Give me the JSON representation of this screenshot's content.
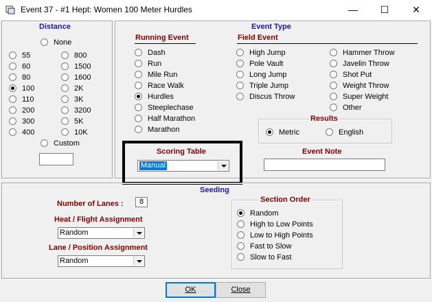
{
  "window": {
    "title": "Event 37 - #1 Hept: Women 100 Meter Hurdles",
    "controls": {
      "minimize": "—",
      "maximize": "☐",
      "close": "✕"
    }
  },
  "distance": {
    "title": "Distance",
    "none_label": "None",
    "options_left": [
      "55",
      "60",
      "80",
      "100",
      "110",
      "200",
      "300",
      "400"
    ],
    "options_right": [
      "800",
      "1500",
      "1600",
      "2K",
      "3K",
      "3200",
      "5K",
      "10K"
    ],
    "selected": "100",
    "custom_label": "Custom",
    "custom_value": ""
  },
  "event_type": {
    "title": "Event Type",
    "running_title": "Running Event",
    "running": [
      "Dash",
      "Run",
      "Mile Run",
      "Race Walk",
      "Hurdles",
      "Steeplechase",
      "Half Marathon",
      "Marathon"
    ],
    "running_selected": "Hurdles",
    "field_title": "Field Event",
    "field_col1": [
      "High Jump",
      "Pole Vault",
      "Long Jump",
      "Triple Jump",
      "Discus Throw"
    ],
    "field_col2": [
      "Hammer Throw",
      "Javelin Throw",
      "Shot Put",
      "Weight Throw",
      "Super Weight",
      "Other"
    ],
    "results": {
      "title": "Results",
      "metric": "Metric",
      "english": "English",
      "selected": "Metric"
    },
    "scoring_table": {
      "title": "Scoring Table",
      "value": "Manual"
    },
    "event_note": {
      "title": "Event Note",
      "value": ""
    }
  },
  "seeding": {
    "title": "Seeding",
    "lanes_label": "Number of Lanes :",
    "lanes_value": "8",
    "heat_label": "Heat / Flight Assignment",
    "heat_value": "Random",
    "lane_label": "Lane / Position Assignment",
    "lane_value": "Random",
    "section_order": {
      "title": "Section Order",
      "options": [
        "Random",
        "High to Low Points",
        "Low to High Points",
        "Fast to Slow",
        "Slow to Fast"
      ],
      "selected": "Random"
    }
  },
  "buttons": {
    "ok": "OK",
    "close": "Close"
  }
}
